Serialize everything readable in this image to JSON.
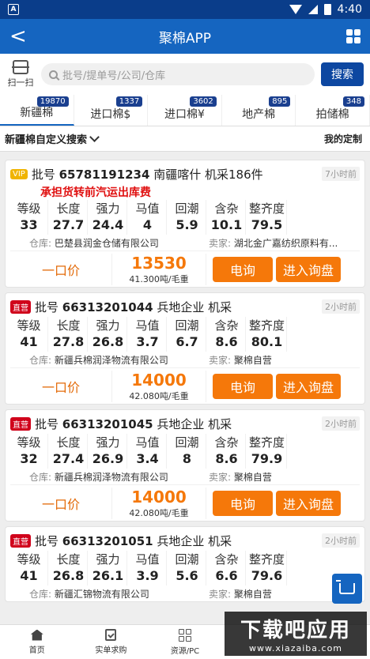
{
  "status": {
    "time": "4:40",
    "notif": "A"
  },
  "appbar": {
    "title": "聚棉APP",
    "back": "<"
  },
  "search": {
    "scan_label": "扫一扫",
    "placeholder": "批号/提单号/公司/仓库",
    "button": "搜索"
  },
  "tabs": [
    {
      "label": "新疆棉",
      "badge": "19870"
    },
    {
      "label": "进口棉$",
      "badge": "1337"
    },
    {
      "label": "进口棉¥",
      "badge": "3602"
    },
    {
      "label": "地产棉",
      "badge": "895"
    },
    {
      "label": "拍储棉",
      "badge": "348"
    }
  ],
  "filter": {
    "title": "新疆棉自定义搜索",
    "mine": "我的定制"
  },
  "spec_headers": [
    "等级",
    "长度",
    "强力",
    "马值",
    "回潮",
    "含杂",
    "整齐度"
  ],
  "labels": {
    "warehouse": "仓库:",
    "seller": "卖家:",
    "fixed": "一口价",
    "call": "电询",
    "inquiry": "进入询盘",
    "lot_prefix": "批号"
  },
  "cards": [
    {
      "tag": "VIP",
      "tag_type": "vip",
      "lot": "65781191234",
      "suffix": "南疆喀什 机采186件",
      "time": "7小时前",
      "promo": "承担货转前汽运出库费",
      "values": [
        "33",
        "27.7",
        "24.4",
        "4",
        "5.9",
        "10.1",
        "79.5"
      ],
      "warehouse": "巴楚县润金仓储有限公司",
      "seller": "湖北金广嘉纺织原料有...",
      "price": "13530",
      "unit": "41.300吨/毛重"
    },
    {
      "tag": "直营",
      "tag_type": "zy",
      "lot": "66313201044",
      "suffix": "兵地企业 机采",
      "time": "2小时前",
      "promo": "",
      "values": [
        "41",
        "27.8",
        "26.8",
        "3.7",
        "6.7",
        "8.6",
        "80.1"
      ],
      "warehouse": "新疆兵棉润泽物流有限公司",
      "seller": "聚棉自营",
      "price": "14000",
      "unit": "42.080吨/毛重"
    },
    {
      "tag": "直营",
      "tag_type": "zy",
      "lot": "66313201045",
      "suffix": "兵地企业 机采",
      "time": "2小时前",
      "promo": "",
      "values": [
        "32",
        "27.4",
        "26.9",
        "3.4",
        "8",
        "8.6",
        "79.9"
      ],
      "warehouse": "新疆兵棉润泽物流有限公司",
      "seller": "聚棉自营",
      "price": "14000",
      "unit": "42.080吨/毛重"
    },
    {
      "tag": "直营",
      "tag_type": "zy",
      "lot": "66313201051",
      "suffix": "兵地企业 机采",
      "time": "2小时前",
      "promo": "",
      "values": [
        "41",
        "26.8",
        "26.1",
        "3.9",
        "5.6",
        "6.6",
        "79.6"
      ],
      "warehouse": "新疆汇锦物流有限公司",
      "seller": "聚棉自营",
      "price": "",
      "unit": ""
    }
  ],
  "nav": [
    {
      "label": "首页",
      "icon": "home-icon"
    },
    {
      "label": "实单求购",
      "icon": "order-icon"
    },
    {
      "label": "资源/PC",
      "icon": "resources-icon"
    }
  ],
  "watermark": {
    "line1": "下载吧应用",
    "line2": "www.xiazaiba.com"
  }
}
